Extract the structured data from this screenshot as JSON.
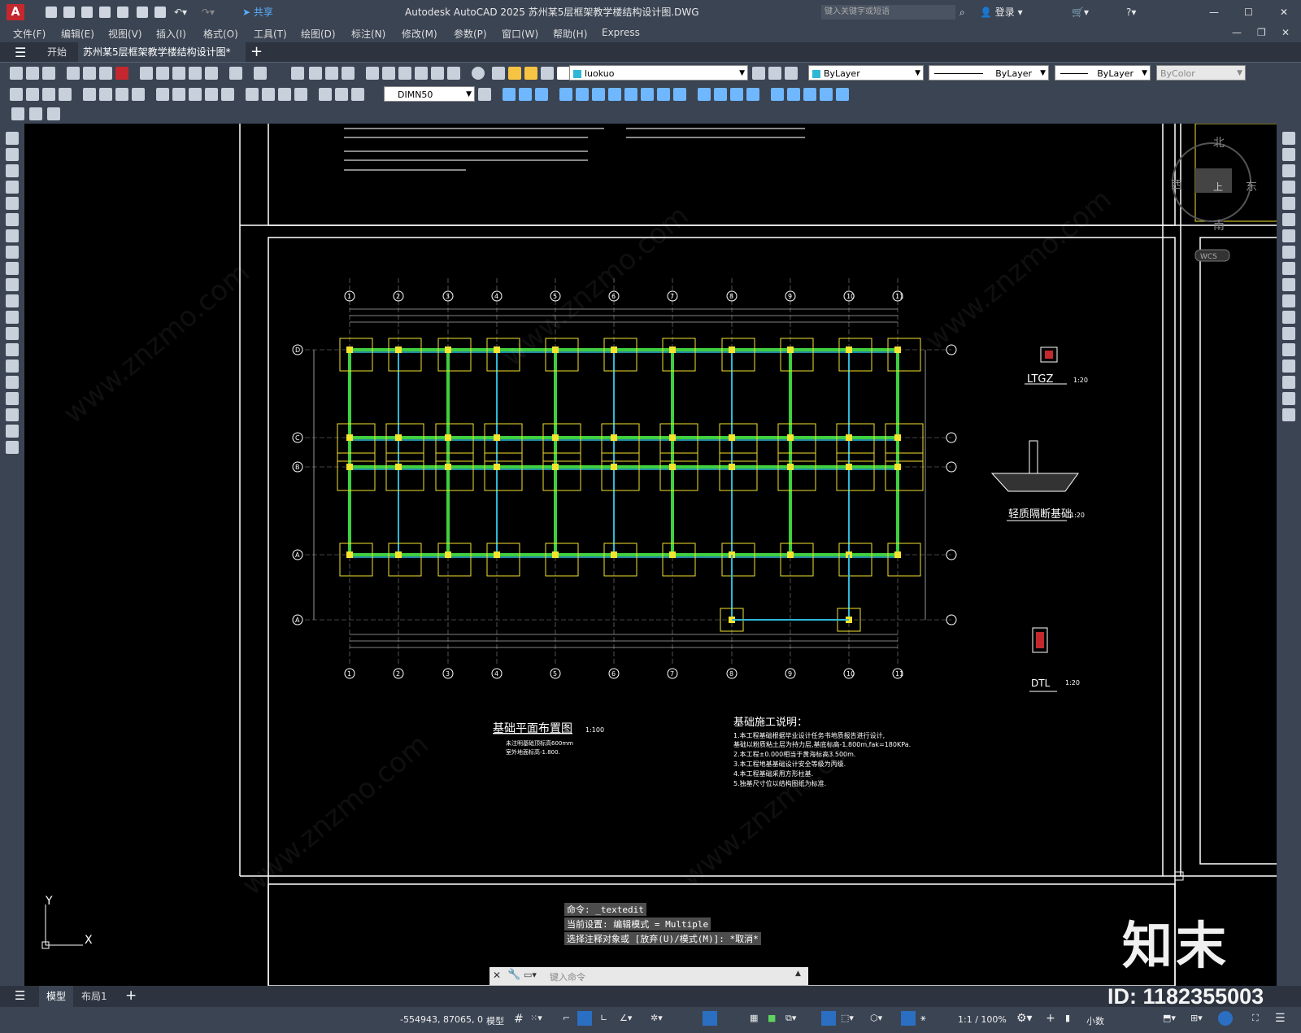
{
  "app": {
    "title": "Autodesk AutoCAD 2025    苏州某5层框架教学楼结构设计图.DWG",
    "share": "共享",
    "search_placeholder": "键入关键字或短语",
    "login": "登录"
  },
  "menu": [
    "文件(F)",
    "编辑(E)",
    "视图(V)",
    "插入(I)",
    "格式(O)",
    "工具(T)",
    "绘图(D)",
    "标注(N)",
    "修改(M)",
    "参数(P)",
    "窗口(W)",
    "帮助(H)",
    "Express"
  ],
  "tabs": {
    "start": "开始",
    "doc": "苏州某5层框架教学楼结构设计图*"
  },
  "toolbar": {
    "layer": "luokuo",
    "color": "ByLayer",
    "linetype": "ByLayer",
    "lineweight": "ByLayer",
    "plotstyle": "ByColor",
    "dimstyle": "DIMN50"
  },
  "drawing": {
    "plan_title": "基础平面布置图",
    "plan_scale": "1:100",
    "plan_note1": "未注明基础顶标高600mm",
    "plan_note2": "室外地面标高-1.800.",
    "notes_title": "基础施工说明：",
    "notes": [
      "1.本工程基础根据毕业设计任务书地质报告进行设计,",
      "  基础以粉质粘土层为持力层,基底标高-1.800m,fak=180KPa.",
      "2.本工程±0.000相当于黄海标高3.500m.",
      "3.本工程地基基础设计安全等级为丙级.",
      "4.本工程基础采用方形柱基.",
      "5.独基尺寸位以结构图纸为标准."
    ],
    "detail1": "LTGZ",
    "detail1_scale": "1:20",
    "detail2": "轻质隔断基础",
    "detail2_scale": "1:20",
    "detail3": "DTL",
    "detail3_scale": "1:20",
    "axes_top": [
      "1",
      "2",
      "3",
      "4",
      "5",
      "6",
      "7",
      "8",
      "9",
      "10",
      "11"
    ],
    "axes_left": [
      "D",
      "C",
      "B",
      "A",
      "A"
    ],
    "compass": {
      "n": "北",
      "e": "东",
      "s": "南",
      "w": "西",
      "up": "上"
    },
    "wcs": "WCS",
    "ucs_x": "X",
    "ucs_y": "Y"
  },
  "command": {
    "line1": "命令: _textedit",
    "line2": "当前设置: 编辑模式 = Multiple",
    "line3": "选择注释对象或 [放弃(U)/模式(M)]: *取消*",
    "placeholder": "键入命令"
  },
  "layout_tabs": [
    "模型",
    "布局1"
  ],
  "status": {
    "coords": "-554943, 87065, 0",
    "model": "模型",
    "scale": "1:1 / 100%",
    "units": "小数"
  },
  "watermark": {
    "brand": "知末",
    "id": "ID: 1182355003",
    "site": "www.znzmo.com"
  }
}
